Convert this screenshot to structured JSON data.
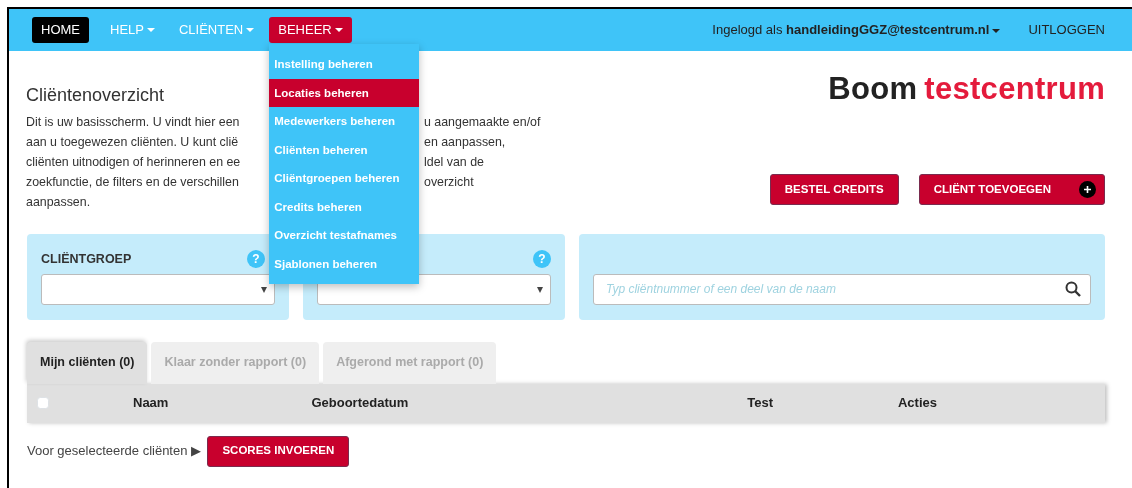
{
  "nav": {
    "items": [
      {
        "label": "HOME",
        "selected": true,
        "expanded": false,
        "caret": false
      },
      {
        "label": "HELP",
        "selected": false,
        "expanded": false,
        "caret": true
      },
      {
        "label": "CLIËNTEN",
        "selected": false,
        "expanded": false,
        "caret": true
      },
      {
        "label": "BEHEER",
        "selected": false,
        "expanded": true,
        "caret": true
      }
    ],
    "user": {
      "prefix": "Ingelogd als",
      "email": "handleidingGGZ@testcentrum.nl"
    },
    "logout": "UITLOGGEN"
  },
  "dropdown": {
    "items": [
      {
        "label": "Instelling beheren",
        "selected": false
      },
      {
        "label": "Locaties beheren",
        "selected": true
      },
      {
        "label": "Medewerkers beheren",
        "selected": false
      },
      {
        "label": "Cliënten beheren",
        "selected": false
      },
      {
        "label": "Cliëntgroepen beheren",
        "selected": false
      },
      {
        "label": "Credits beheren",
        "selected": false
      },
      {
        "label": "Overzicht testafnames",
        "selected": false
      },
      {
        "label": "Sjablonen beheren",
        "selected": false
      }
    ]
  },
  "page": {
    "title": "Cliëntenoverzicht",
    "intro_lines": [
      {
        "left": "Dit is uw basisscherm. U vindt hier een",
        "right": "u aangemaakte en/of"
      },
      {
        "left": "aan u toegewezen cliënten. U kunt clië",
        "right": "en aanpassen,"
      },
      {
        "left": "cliënten uitnodigen of herinneren en ee",
        "right": "ldel van de"
      },
      {
        "left": "zoekfunctie, de filters en de verschillen",
        "right": "overzicht"
      },
      {
        "left": "aanpassen."
      }
    ]
  },
  "logo": {
    "part1": "Boom",
    "part2": "testcentrum"
  },
  "actions": [
    {
      "label": "BESTEL CREDITS",
      "kind": "plain"
    },
    {
      "label": "CLIËNT TOEVOEGEN",
      "kind": "add"
    }
  ],
  "filters": [
    {
      "kind": "select",
      "label": "CLIËNTGROEP",
      "help": "?"
    },
    {
      "kind": "select",
      "help": "?"
    },
    {
      "kind": "search",
      "placeholder": "Typ cliëntnummer of een deel van de naam"
    }
  ],
  "tabs": [
    {
      "label": "Mijn cliënten (0)",
      "selected": true
    },
    {
      "label": "Klaar zonder rapport (0)",
      "selected": false
    },
    {
      "label": "Afgerond met rapport (0)",
      "selected": false
    }
  ],
  "table": {
    "select_all": {
      "checked": false
    },
    "columns": [
      "Naam",
      "Geboortedatum",
      "Test",
      "Acties"
    ]
  },
  "footer": {
    "text": "Voor geselecteerde cliënten",
    "arrow": "▶",
    "button": "SCORES INVOEREN"
  }
}
